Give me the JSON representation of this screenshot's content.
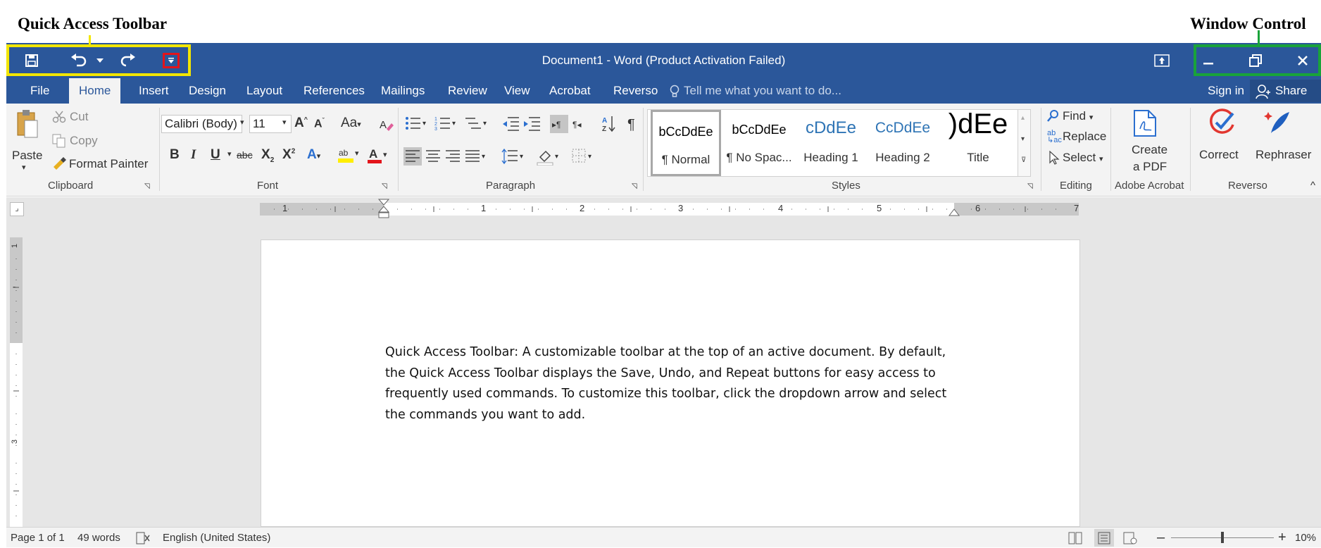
{
  "annotations": {
    "qat_label": "Quick Access Toolbar",
    "window_label": "Window Control",
    "qat_color": "#f2e600",
    "window_color": "#19a33a",
    "dropdown_color": "#e3141b"
  },
  "window": {
    "title": "Document1 - Word (Product Activation Failed)",
    "accent": "#2b579a"
  },
  "qat": {
    "icons": [
      "save-icon",
      "undo-icon",
      "redo-icon",
      "customize-dropdown-icon"
    ]
  },
  "tabs": {
    "items": [
      "File",
      "Home",
      "Insert",
      "Design",
      "Layout",
      "References",
      "Mailings",
      "Review",
      "View",
      "Acrobat",
      "Reverso"
    ],
    "active": "Home",
    "tell_me": "Tell me what you want to do...",
    "sign_in": "Sign in",
    "share": "Share"
  },
  "ribbon": {
    "clipboard": {
      "paste": "Paste",
      "cut": "Cut",
      "copy": "Copy",
      "format_painter": "Format Painter",
      "label": "Clipboard"
    },
    "font": {
      "name": "Calibri (Body)",
      "size": "11",
      "change_case": "Aa",
      "label": "Font"
    },
    "paragraph": {
      "label": "Paragraph"
    },
    "styles": {
      "items": [
        {
          "preview": "bCcDdEe",
          "name": "¶ Normal"
        },
        {
          "preview": "bCcDdEe",
          "name": "¶ No Spac..."
        },
        {
          "preview": "cDdEe",
          "name": "Heading 1"
        },
        {
          "preview": "CcDdEe",
          "name": "Heading 2"
        },
        {
          "preview": ")dEe",
          "name": "Title"
        }
      ],
      "label": "Styles"
    },
    "editing": {
      "find": "Find",
      "replace": "Replace",
      "select": "Select",
      "label": "Editing"
    },
    "adobe": {
      "create_pdf_line1": "Create",
      "create_pdf_line2": "a PDF",
      "label": "Adobe Acrobat"
    },
    "reverso": {
      "correct": "Correct",
      "rephraser": "Rephraser",
      "label": "Reverso"
    }
  },
  "ruler": {
    "h_numbers": [
      "1",
      "1",
      "2",
      "3",
      "4",
      "5",
      "6",
      "7"
    ],
    "v_numbers": [
      "1",
      "3"
    ]
  },
  "document": {
    "body": "Quick Access Toolbar: A customizable toolbar at the top of an active document. By default, the Quick Access Toolbar displays the Save, Undo, and Repeat buttons for easy access to frequently used commands. To customize this toolbar, click the dropdown arrow and select the commands you want to add."
  },
  "status": {
    "page": "Page 1 of 1",
    "words": "49 words",
    "language": "English (United States)",
    "zoom": "10%"
  }
}
